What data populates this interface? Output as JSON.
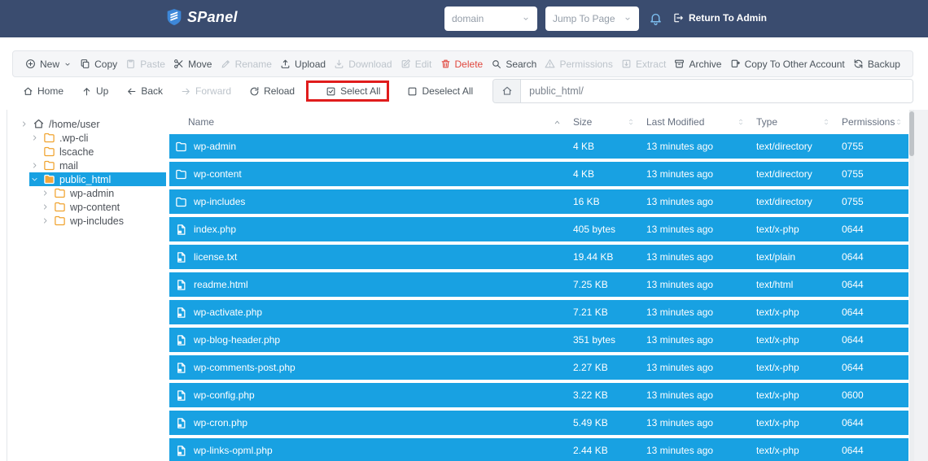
{
  "colors": {
    "navbar": "#3a4c6f",
    "accent": "#18a1e2",
    "danger": "#e01c1c",
    "danger_soft": "#e0483f",
    "folder": "#f0a32f"
  },
  "navbar": {
    "brand": "SPanel",
    "domain_select": "domain",
    "jump_select": "Jump To Page",
    "return_admin": "Return To Admin"
  },
  "toolbar": {
    "buttons": [
      {
        "label": "New",
        "icon": "plus-circle",
        "state": "enabled",
        "caret": true
      },
      {
        "label": "Copy",
        "icon": "copy",
        "state": "enabled"
      },
      {
        "label": "Paste",
        "icon": "paste",
        "state": "disabled"
      },
      {
        "label": "Move",
        "icon": "scissors",
        "state": "enabled"
      },
      {
        "label": "Rename",
        "icon": "pencil",
        "state": "disabled"
      },
      {
        "label": "Upload",
        "icon": "upload",
        "state": "enabled"
      },
      {
        "label": "Download",
        "icon": "download",
        "state": "disabled"
      },
      {
        "label": "Edit",
        "icon": "edit",
        "state": "disabled"
      },
      {
        "label": "Delete",
        "icon": "trash",
        "state": "danger"
      },
      {
        "label": "Search",
        "icon": "search",
        "state": "enabled"
      },
      {
        "label": "Permissions",
        "icon": "warning",
        "state": "disabled"
      },
      {
        "label": "Extract",
        "icon": "extract",
        "state": "disabled"
      },
      {
        "label": "Archive",
        "icon": "archive",
        "state": "enabled"
      },
      {
        "label": "Copy To Other Account",
        "icon": "copy-account",
        "state": "enabled"
      },
      {
        "label": "Backup",
        "icon": "backup",
        "state": "enabled"
      }
    ]
  },
  "navrow": {
    "buttons": [
      {
        "label": "Home",
        "icon": "home",
        "state": "enabled"
      },
      {
        "label": "Up",
        "icon": "arrow-up",
        "state": "enabled"
      },
      {
        "label": "Back",
        "icon": "arrow-left",
        "state": "enabled"
      },
      {
        "label": "Forward",
        "icon": "arrow-right",
        "state": "disabled"
      },
      {
        "label": "Reload",
        "icon": "reload",
        "state": "enabled"
      },
      {
        "label": "Select All",
        "icon": "check-sq",
        "state": "enabled",
        "highlighted": true
      },
      {
        "label": "Deselect All",
        "icon": "empty-sq",
        "state": "enabled"
      }
    ]
  },
  "pathbar": {
    "value": "public_html/"
  },
  "sidebar": {
    "tree": [
      {
        "label": "/home/user",
        "level": 0,
        "icon": "home",
        "expander": "right",
        "selected": false
      },
      {
        "label": ".wp-cli",
        "level": 1,
        "icon": "folder",
        "expander": "right",
        "selected": false
      },
      {
        "label": "lscache",
        "level": 1,
        "icon": "folder",
        "expander": "none",
        "selected": false
      },
      {
        "label": "mail",
        "level": 1,
        "icon": "folder",
        "expander": "right",
        "selected": false
      },
      {
        "label": "public_html",
        "level": 1,
        "icon": "folder",
        "expander": "down",
        "selected": true
      },
      {
        "label": "wp-admin",
        "level": 2,
        "icon": "folder",
        "expander": "right",
        "selected": false
      },
      {
        "label": "wp-content",
        "level": 2,
        "icon": "folder",
        "expander": "right",
        "selected": false
      },
      {
        "label": "wp-includes",
        "level": 2,
        "icon": "folder",
        "expander": "right",
        "selected": false
      }
    ]
  },
  "table": {
    "columns": [
      "Name",
      "Size",
      "Last Modified",
      "Type",
      "Permissions"
    ],
    "rows": [
      {
        "name": "wp-admin",
        "icon": "folder",
        "size": "4 KB",
        "modified": "13 minutes ago",
        "type": "text/directory",
        "permissions": "0755",
        "selected": true
      },
      {
        "name": "wp-content",
        "icon": "folder",
        "size": "4 KB",
        "modified": "13 minutes ago",
        "type": "text/directory",
        "permissions": "0755",
        "selected": true
      },
      {
        "name": "wp-includes",
        "icon": "folder",
        "size": "16 KB",
        "modified": "13 minutes ago",
        "type": "text/directory",
        "permissions": "0755",
        "selected": true
      },
      {
        "name": "index.php",
        "icon": "file",
        "size": "405 bytes",
        "modified": "13 minutes ago",
        "type": "text/x-php",
        "permissions": "0644",
        "selected": true
      },
      {
        "name": "license.txt",
        "icon": "file",
        "size": "19.44 KB",
        "modified": "13 minutes ago",
        "type": "text/plain",
        "permissions": "0644",
        "selected": true
      },
      {
        "name": "readme.html",
        "icon": "file",
        "size": "7.25 KB",
        "modified": "13 minutes ago",
        "type": "text/html",
        "permissions": "0644",
        "selected": true
      },
      {
        "name": "wp-activate.php",
        "icon": "file",
        "size": "7.21 KB",
        "modified": "13 minutes ago",
        "type": "text/x-php",
        "permissions": "0644",
        "selected": true
      },
      {
        "name": "wp-blog-header.php",
        "icon": "file",
        "size": "351 bytes",
        "modified": "13 minutes ago",
        "type": "text/x-php",
        "permissions": "0644",
        "selected": true
      },
      {
        "name": "wp-comments-post.php",
        "icon": "file",
        "size": "2.27 KB",
        "modified": "13 minutes ago",
        "type": "text/x-php",
        "permissions": "0644",
        "selected": true
      },
      {
        "name": "wp-config.php",
        "icon": "file",
        "size": "3.22 KB",
        "modified": "13 minutes ago",
        "type": "text/x-php",
        "permissions": "0600",
        "selected": true
      },
      {
        "name": "wp-cron.php",
        "icon": "file",
        "size": "5.49 KB",
        "modified": "13 minutes ago",
        "type": "text/x-php",
        "permissions": "0644",
        "selected": true
      },
      {
        "name": "wp-links-opml.php",
        "icon": "file",
        "size": "2.44 KB",
        "modified": "13 minutes ago",
        "type": "text/x-php",
        "permissions": "0644",
        "selected": true
      }
    ]
  }
}
